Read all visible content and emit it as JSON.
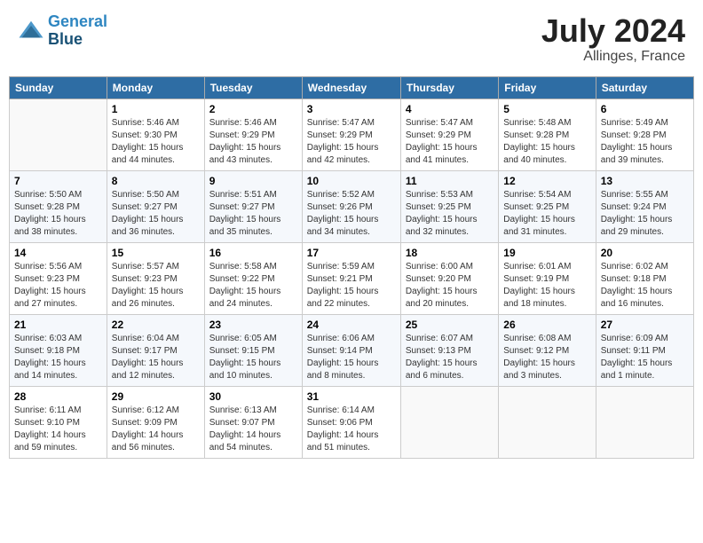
{
  "header": {
    "logo_line1": "General",
    "logo_line2": "Blue",
    "month_year": "July 2024",
    "location": "Allinges, France"
  },
  "weekdays": [
    "Sunday",
    "Monday",
    "Tuesday",
    "Wednesday",
    "Thursday",
    "Friday",
    "Saturday"
  ],
  "weeks": [
    [
      {
        "num": "",
        "info": ""
      },
      {
        "num": "1",
        "info": "Sunrise: 5:46 AM\nSunset: 9:30 PM\nDaylight: 15 hours\nand 44 minutes."
      },
      {
        "num": "2",
        "info": "Sunrise: 5:46 AM\nSunset: 9:29 PM\nDaylight: 15 hours\nand 43 minutes."
      },
      {
        "num": "3",
        "info": "Sunrise: 5:47 AM\nSunset: 9:29 PM\nDaylight: 15 hours\nand 42 minutes."
      },
      {
        "num": "4",
        "info": "Sunrise: 5:47 AM\nSunset: 9:29 PM\nDaylight: 15 hours\nand 41 minutes."
      },
      {
        "num": "5",
        "info": "Sunrise: 5:48 AM\nSunset: 9:28 PM\nDaylight: 15 hours\nand 40 minutes."
      },
      {
        "num": "6",
        "info": "Sunrise: 5:49 AM\nSunset: 9:28 PM\nDaylight: 15 hours\nand 39 minutes."
      }
    ],
    [
      {
        "num": "7",
        "info": "Sunrise: 5:50 AM\nSunset: 9:28 PM\nDaylight: 15 hours\nand 38 minutes."
      },
      {
        "num": "8",
        "info": "Sunrise: 5:50 AM\nSunset: 9:27 PM\nDaylight: 15 hours\nand 36 minutes."
      },
      {
        "num": "9",
        "info": "Sunrise: 5:51 AM\nSunset: 9:27 PM\nDaylight: 15 hours\nand 35 minutes."
      },
      {
        "num": "10",
        "info": "Sunrise: 5:52 AM\nSunset: 9:26 PM\nDaylight: 15 hours\nand 34 minutes."
      },
      {
        "num": "11",
        "info": "Sunrise: 5:53 AM\nSunset: 9:25 PM\nDaylight: 15 hours\nand 32 minutes."
      },
      {
        "num": "12",
        "info": "Sunrise: 5:54 AM\nSunset: 9:25 PM\nDaylight: 15 hours\nand 31 minutes."
      },
      {
        "num": "13",
        "info": "Sunrise: 5:55 AM\nSunset: 9:24 PM\nDaylight: 15 hours\nand 29 minutes."
      }
    ],
    [
      {
        "num": "14",
        "info": "Sunrise: 5:56 AM\nSunset: 9:23 PM\nDaylight: 15 hours\nand 27 minutes."
      },
      {
        "num": "15",
        "info": "Sunrise: 5:57 AM\nSunset: 9:23 PM\nDaylight: 15 hours\nand 26 minutes."
      },
      {
        "num": "16",
        "info": "Sunrise: 5:58 AM\nSunset: 9:22 PM\nDaylight: 15 hours\nand 24 minutes."
      },
      {
        "num": "17",
        "info": "Sunrise: 5:59 AM\nSunset: 9:21 PM\nDaylight: 15 hours\nand 22 minutes."
      },
      {
        "num": "18",
        "info": "Sunrise: 6:00 AM\nSunset: 9:20 PM\nDaylight: 15 hours\nand 20 minutes."
      },
      {
        "num": "19",
        "info": "Sunrise: 6:01 AM\nSunset: 9:19 PM\nDaylight: 15 hours\nand 18 minutes."
      },
      {
        "num": "20",
        "info": "Sunrise: 6:02 AM\nSunset: 9:18 PM\nDaylight: 15 hours\nand 16 minutes."
      }
    ],
    [
      {
        "num": "21",
        "info": "Sunrise: 6:03 AM\nSunset: 9:18 PM\nDaylight: 15 hours\nand 14 minutes."
      },
      {
        "num": "22",
        "info": "Sunrise: 6:04 AM\nSunset: 9:17 PM\nDaylight: 15 hours\nand 12 minutes."
      },
      {
        "num": "23",
        "info": "Sunrise: 6:05 AM\nSunset: 9:15 PM\nDaylight: 15 hours\nand 10 minutes."
      },
      {
        "num": "24",
        "info": "Sunrise: 6:06 AM\nSunset: 9:14 PM\nDaylight: 15 hours\nand 8 minutes."
      },
      {
        "num": "25",
        "info": "Sunrise: 6:07 AM\nSunset: 9:13 PM\nDaylight: 15 hours\nand 6 minutes."
      },
      {
        "num": "26",
        "info": "Sunrise: 6:08 AM\nSunset: 9:12 PM\nDaylight: 15 hours\nand 3 minutes."
      },
      {
        "num": "27",
        "info": "Sunrise: 6:09 AM\nSunset: 9:11 PM\nDaylight: 15 hours\nand 1 minute."
      }
    ],
    [
      {
        "num": "28",
        "info": "Sunrise: 6:11 AM\nSunset: 9:10 PM\nDaylight: 14 hours\nand 59 minutes."
      },
      {
        "num": "29",
        "info": "Sunrise: 6:12 AM\nSunset: 9:09 PM\nDaylight: 14 hours\nand 56 minutes."
      },
      {
        "num": "30",
        "info": "Sunrise: 6:13 AM\nSunset: 9:07 PM\nDaylight: 14 hours\nand 54 minutes."
      },
      {
        "num": "31",
        "info": "Sunrise: 6:14 AM\nSunset: 9:06 PM\nDaylight: 14 hours\nand 51 minutes."
      },
      {
        "num": "",
        "info": ""
      },
      {
        "num": "",
        "info": ""
      },
      {
        "num": "",
        "info": ""
      }
    ]
  ]
}
